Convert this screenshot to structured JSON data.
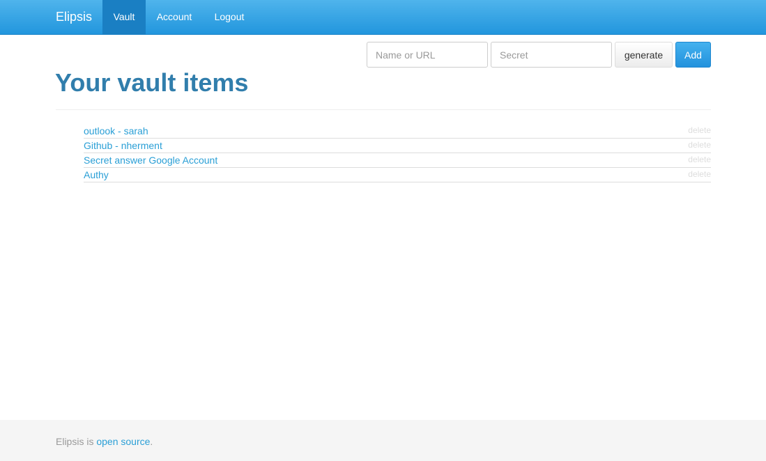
{
  "navbar": {
    "brand": "Elipsis",
    "items": [
      {
        "label": "Vault",
        "active": true
      },
      {
        "label": "Account",
        "active": false
      },
      {
        "label": "Logout",
        "active": false
      }
    ]
  },
  "add_form": {
    "name_placeholder": "Name or URL",
    "secret_placeholder": "Secret",
    "generate_label": "generate",
    "add_label": "Add"
  },
  "page": {
    "title": "Your vault items"
  },
  "vault_items": [
    {
      "name": "outlook - sarah",
      "delete_label": "delete"
    },
    {
      "name": "Github - nherment",
      "delete_label": "delete"
    },
    {
      "name": "Secret answer Google Account",
      "delete_label": "delete"
    },
    {
      "name": "Authy",
      "delete_label": "delete"
    }
  ],
  "footer": {
    "text_prefix": "Elipsis is ",
    "link_text": "open source",
    "text_suffix": "."
  },
  "colors": {
    "navbar": "#2a9fd6",
    "title": "#317eac",
    "link": "#2a9fd6",
    "delete": "#dddddd"
  }
}
